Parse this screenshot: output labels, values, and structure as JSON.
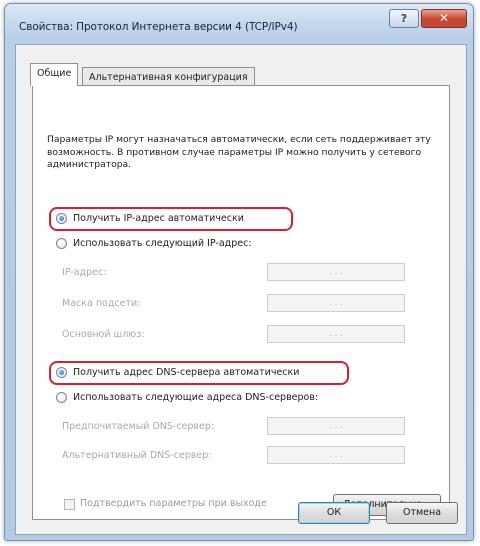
{
  "window": {
    "title": "Свойства: Протокол Интернета версии 4 (TCP/IPv4)",
    "help_label": "?",
    "close_label": "✕"
  },
  "tabs": [
    {
      "label": "Общие",
      "active": true
    },
    {
      "label": "Альтернативная конфигурация",
      "active": false
    }
  ],
  "info_text": "Параметры IP могут назначаться автоматически, если сеть поддерживает эту возможность. В противном случае параметры IP можно получить у сетевого администратора.",
  "ip_section": {
    "auto_label": "Получить IP-адрес автоматически",
    "manual_label": "Использовать следующий IP-адрес:",
    "selected": "auto",
    "fields": [
      {
        "label": "IP-адрес:",
        "value": " .  .  . "
      },
      {
        "label": "Маска подсети:",
        "value": " .  .  . "
      },
      {
        "label": "Основной шлюз:",
        "value": " .  .  . "
      }
    ]
  },
  "dns_section": {
    "auto_label": "Получить адрес DNS-сервера автоматически",
    "manual_label": "Использовать следующие адреса DNS-серверов:",
    "selected": "auto",
    "fields": [
      {
        "label": "Предпочитаемый DNS-сервер:",
        "value": " .  .  . "
      },
      {
        "label": "Альтернативный DNS-сервер:",
        "value": " .  .  . "
      }
    ]
  },
  "validate_checkbox": {
    "label": "Подтвердить параметры при выходе",
    "checked": false
  },
  "buttons": {
    "advanced": "Дополнительно...",
    "ok": "ОК",
    "cancel": "Отмена"
  },
  "colors": {
    "highlight": "#d8202e",
    "radio_selected": "#1f6bb3",
    "close_button": "#c8432d"
  }
}
